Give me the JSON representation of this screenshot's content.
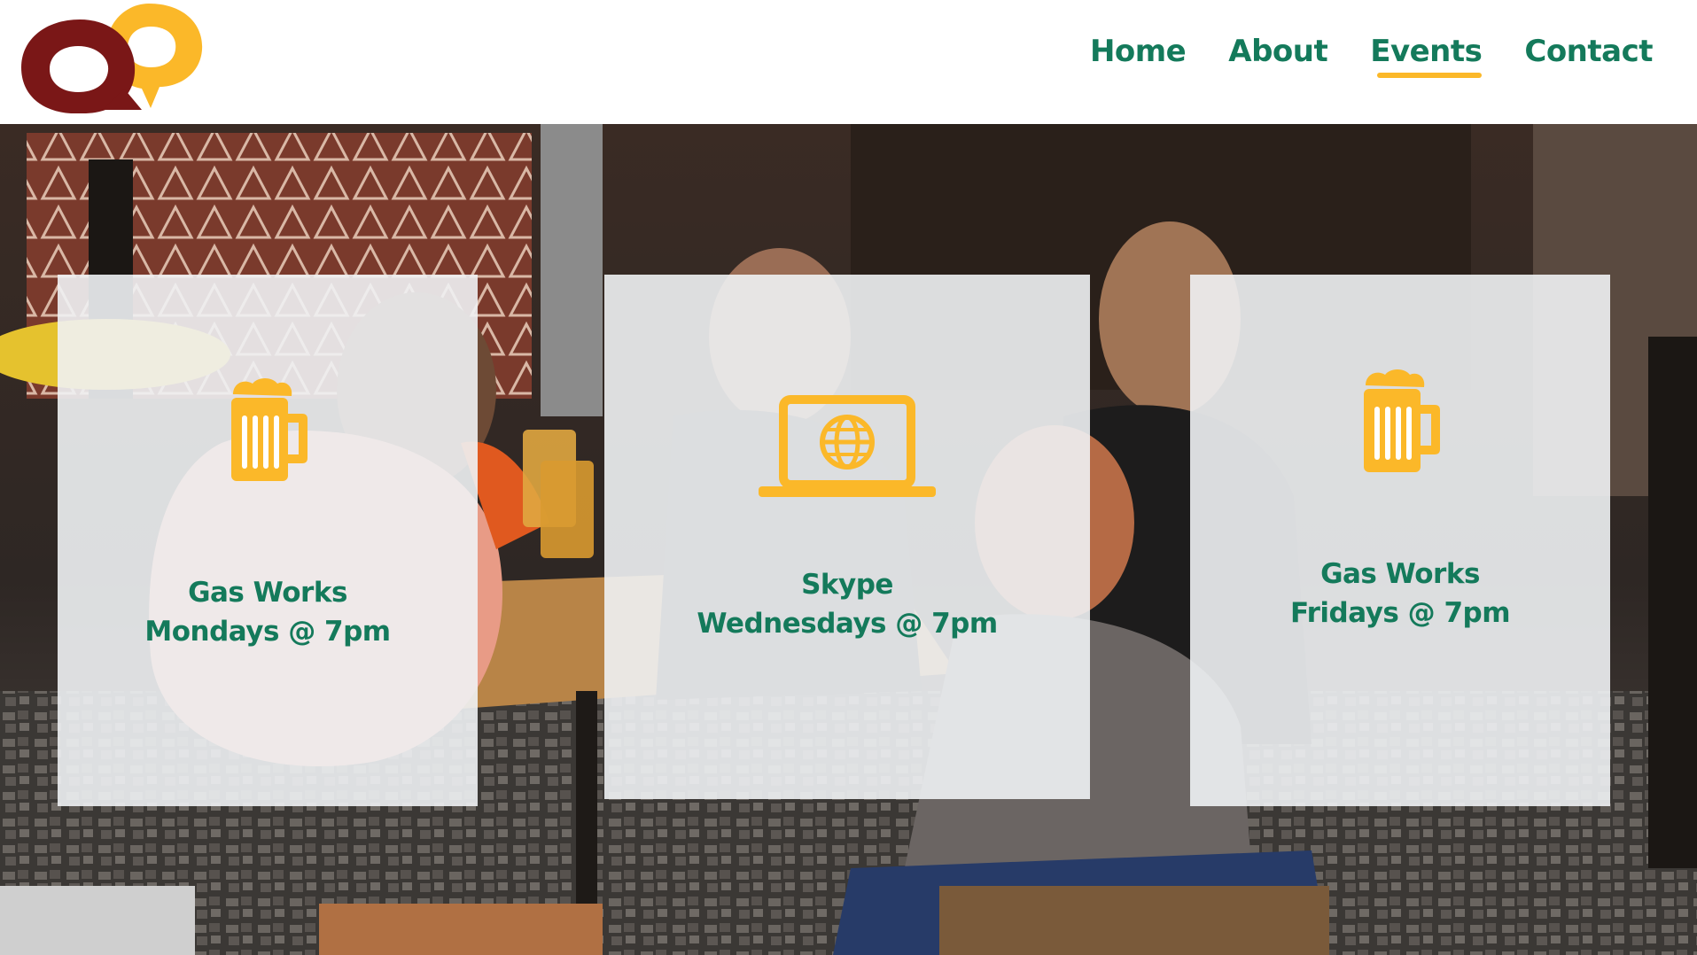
{
  "colors": {
    "brand_green": "#147a5b",
    "brand_yellow": "#fbb829",
    "brand_maroon": "#7a1717"
  },
  "logo": {
    "icon": "speech-bubbles-logo"
  },
  "nav": {
    "items": [
      {
        "label": "Home"
      },
      {
        "label": "About"
      },
      {
        "label": "Events",
        "active": true
      },
      {
        "label": "Contact"
      }
    ]
  },
  "events": [
    {
      "icon": "beer-mug-icon",
      "venue": "Gas Works",
      "when": "Mondays @ 7pm"
    },
    {
      "icon": "laptop-globe-icon",
      "venue": "Skype",
      "when": "Wednesdays @ 7pm"
    },
    {
      "icon": "beer-mug-icon",
      "venue": "Gas Works",
      "when": "Fridays @ 7pm"
    }
  ]
}
